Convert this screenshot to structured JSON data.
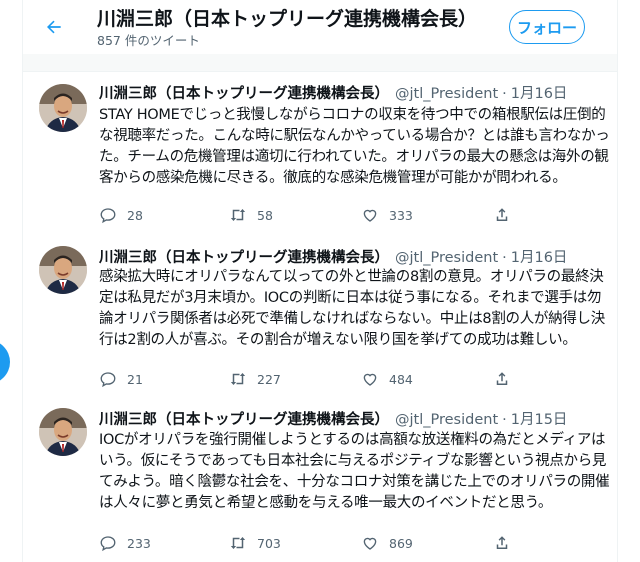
{
  "header": {
    "title": "川淵三郎（日本トップリーグ連携機構会長）",
    "tweet_count": "857 件のツイート",
    "follow_label": "フォロー",
    "back_icon": "arrow-left-icon",
    "accent_color": "#1d9bf0"
  },
  "tweets": [
    {
      "name": "川淵三郎（日本トップリーグ連携機構会長）",
      "handle": "@jtl_President",
      "dot": "·",
      "date": "1月16日",
      "text": "STAY HOMEでじっと我慢しながらコロナの収束を待つ中での箱根駅伝は圧倒的な視聴率だった。こんな時に駅伝なんかやっている場合か？とは誰も言わなかった。チームの危機管理は適切に行われていた。オリパラの最大の懸念は海外の観客からの感染危機に尽きる。徹底的な感染危機管理が可能かが問われる。",
      "replies": "28",
      "retweets": "58",
      "likes": "333"
    },
    {
      "name": "川淵三郎（日本トップリーグ連携機構会長）",
      "handle": "@jtl_President",
      "dot": "·",
      "date": "1月16日",
      "text": "感染拡大時にオリパラなんて以っての外と世論の8割の意見。オリパラの最終決定は私見だが3月末頃か。IOCの判断に日本は従う事になる。それまで選手は勿論オリパラ関係者は必死で準備しなければならない。中止は8割の人が納得し決行は2割の人が喜ぶ。その割合が増えない限り国を挙げての成功は難しい。",
      "replies": "21",
      "retweets": "227",
      "likes": "484"
    },
    {
      "name": "川淵三郎（日本トップリーグ連携機構会長）",
      "handle": "@jtl_President",
      "dot": "·",
      "date": "1月15日",
      "text": "IOCがオリパラを強行開催しようとするのは高額な放送権料の為だとメディアはいう。仮にそうであっても日本社会に与えるポジティブな影響という視点から見てみよう。暗く陰鬱な社会を、十分なコロナ対策を講じた上でのオリパラの開催は人々に夢と勇気と希望と感動を与える唯一最大のイベントだと思う。",
      "replies": "233",
      "retweets": "703",
      "likes": "869"
    }
  ],
  "icons": {
    "reply": "reply-icon",
    "retweet": "retweet-icon",
    "like": "heart-icon",
    "share": "share-icon"
  }
}
